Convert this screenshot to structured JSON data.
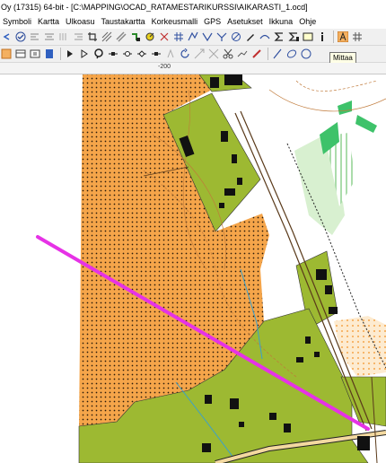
{
  "window": {
    "title": "Oy (17315) 64-bit - [C:\\MAPPING\\OCAD_RATAMESTARIKURSSI\\AIKARASTI_1.ocd]"
  },
  "menu": {
    "items": [
      "Symboli",
      "Kartta",
      "Ulkoasu",
      "Taustakartta",
      "Korkeusmalli",
      "GPS",
      "Asetukset",
      "Ikkuna",
      "Ohje"
    ]
  },
  "tooltip": {
    "text": "Mittaa"
  },
  "ruler": {
    "label": "-200"
  },
  "colors": {
    "open_land": "#f5a54a",
    "forest_green": "#9db932",
    "course_line": "#e632e6",
    "water": "#3aa0cc",
    "building": "#111111"
  }
}
